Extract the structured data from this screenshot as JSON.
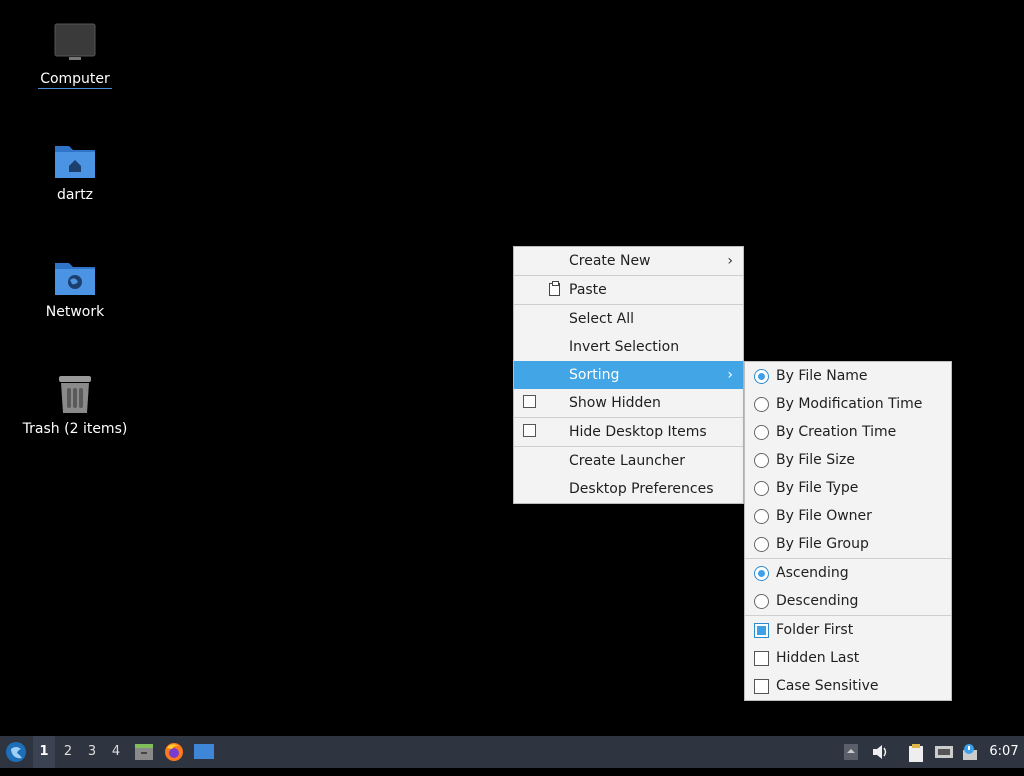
{
  "desktop": {
    "icons": [
      {
        "label": "Computer",
        "icon": "computer-icon"
      },
      {
        "label": "dartz",
        "icon": "home-folder-icon"
      },
      {
        "label": "Network",
        "icon": "network-folder-icon"
      },
      {
        "label": "Trash (2 items)",
        "icon": "trash-icon"
      }
    ]
  },
  "context_menu": {
    "create_new": "Create New",
    "paste": "Paste",
    "select_all": "Select All",
    "invert_selection": "Invert Selection",
    "sorting": "Sorting",
    "show_hidden": "Show Hidden",
    "hide_desktop_items": "Hide Desktop Items",
    "create_launcher": "Create Launcher",
    "desktop_preferences": "Desktop Preferences"
  },
  "sorting_menu": {
    "by_file_name": "By File Name",
    "by_modification_time": "By Modification Time",
    "by_creation_time": "By Creation Time",
    "by_file_size": "By File Size",
    "by_file_type": "By File Type",
    "by_file_owner": "By File Owner",
    "by_file_group": "By File Group",
    "ascending": "Ascending",
    "descending": "Descending",
    "folder_first": "Folder First",
    "hidden_last": "Hidden Last",
    "case_sensitive": "Case Sensitive",
    "selected_sort": "By File Name",
    "selected_order": "Ascending",
    "folder_first_checked": true,
    "hidden_last_checked": false,
    "case_sensitive_checked": false
  },
  "taskbar": {
    "workspaces": [
      "1",
      "2",
      "3",
      "4"
    ],
    "current_workspace": "1",
    "clock": "6:07"
  },
  "colors": {
    "accent": "#42a5e6",
    "taskbar_bg": "#2e3440",
    "menu_bg": "#f3f3f3",
    "folder_blue": "#3f86d9"
  }
}
